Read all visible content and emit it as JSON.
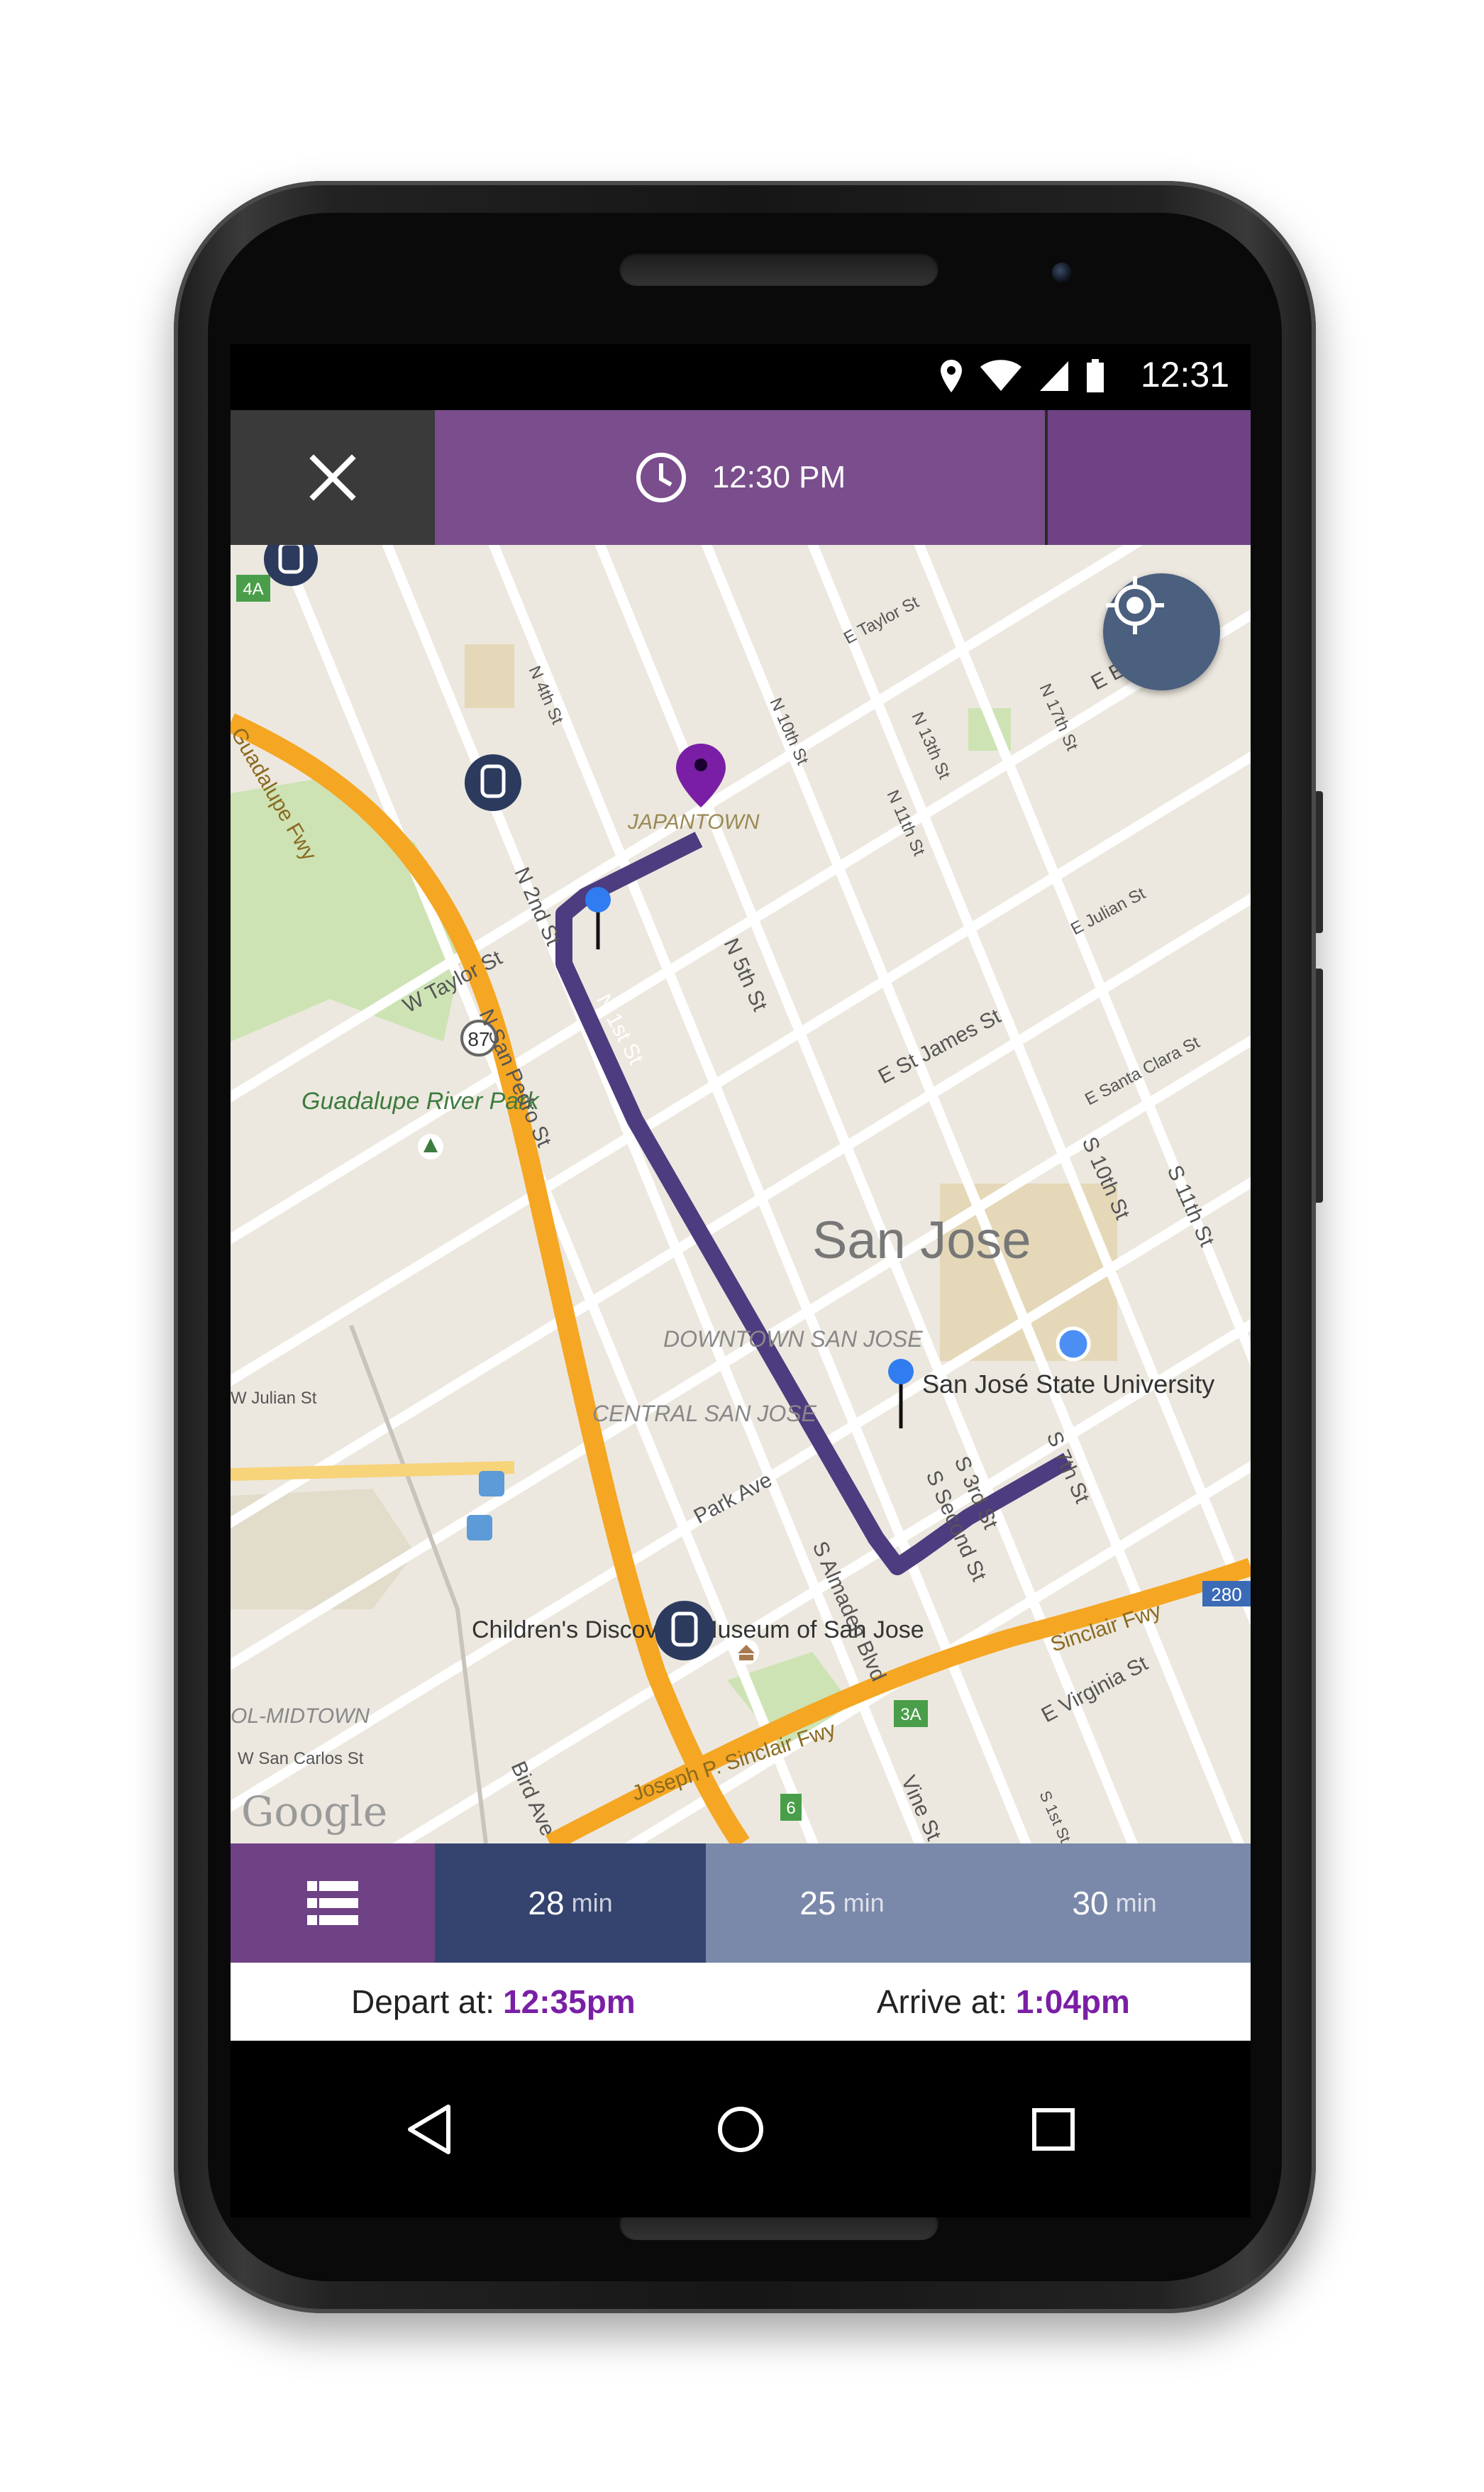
{
  "status_bar": {
    "time": "12:31",
    "icons": [
      "location-icon",
      "wifi-icon",
      "signal-icon",
      "battery-icon"
    ]
  },
  "top_bar": {
    "close_icon": "close-icon",
    "clock_icon": "clock-icon",
    "departure_time": "12:30 PM"
  },
  "map": {
    "city_label": "San Jose",
    "district_labels": [
      "JAPANTOWN",
      "DOWNTOWN SAN JOSE",
      "CENTRAL SAN JOSE",
      "OL-MIDTOWN"
    ],
    "street_labels": [
      "N 4th St",
      "N 2nd St",
      "W Taylor St",
      "N San Pedro St",
      "N 5th St",
      "N 1st St",
      "N 10th St",
      "N 13th St",
      "N 11th St",
      "N 17th St",
      "E Taylor St",
      "E Julian St",
      "E St James St",
      "E Santa Clara St",
      "S 10th St",
      "S 11th St",
      "S 7th St",
      "S 3rd St",
      "S Second St",
      "S Almaden Blvd",
      "Park Ave",
      "W Julian St",
      "W San Carlos St",
      "Bird Ave",
      "Vine St",
      "S 1st St",
      "E Virginia St",
      "Guadalupe Fwy",
      "Sinclair Fwy",
      "Joseph P. Sinclair Fwy",
      "E El"
    ],
    "poi_labels": [
      "Guadalupe River Park",
      "San José State University",
      "Children's Discovery Museum of San Jose"
    ],
    "highway_shields": [
      "87",
      "280",
      "4A",
      "3A",
      "6"
    ],
    "attribution": "Google",
    "route_color": "#4d3c7f",
    "accent_color": "#7a1fa5"
  },
  "route_options": {
    "list_icon": "list-icon",
    "options": [
      {
        "value": "28",
        "unit": "min",
        "selected": true
      },
      {
        "value": "25",
        "unit": "min",
        "selected": false
      },
      {
        "value": "30",
        "unit": "min",
        "selected": false
      }
    ]
  },
  "trip_times": {
    "depart_label": "Depart at:",
    "depart_value": "12:35pm",
    "arrive_label": "Arrive at:",
    "arrive_value": "1:04pm"
  },
  "nav_bar": {
    "back_icon": "back-icon",
    "home_icon": "home-icon",
    "recents_icon": "recents-icon"
  }
}
